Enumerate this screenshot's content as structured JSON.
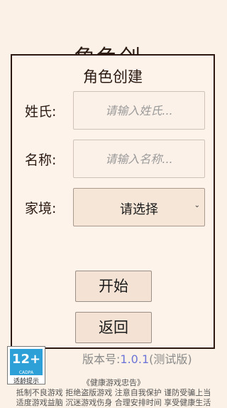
{
  "background_title": "角色创",
  "dialog": {
    "title": "角色创建",
    "surname_label": "姓氏:",
    "surname_placeholder": "请输入姓氏...",
    "name_label": "名称:",
    "name_placeholder": "请输入名称...",
    "family_label": "家境:",
    "family_select_value": "请选择",
    "start_button": "开始",
    "back_button": "返回"
  },
  "age_rating": {
    "rating": "12+",
    "org": "CADPA",
    "caption": "适龄提示"
  },
  "version": {
    "prefix": "版本号:",
    "number": "1.0.1",
    "suffix": "(测试版)"
  },
  "health_notice": {
    "title": "《健康游戏忠告》",
    "line1": "抵制不良游戏 拒绝盗版游戏 注意自我保护 谨防受骗上当",
    "line2": "适度游戏益脑 沉迷游戏伤身 合理安排时间 享受健康生活"
  },
  "colors": {
    "background": "#fbf1e6",
    "dialog_border": "#2c1810",
    "version_accent": "#6d74d8",
    "age_badge_blue": "#2ea0d8"
  }
}
